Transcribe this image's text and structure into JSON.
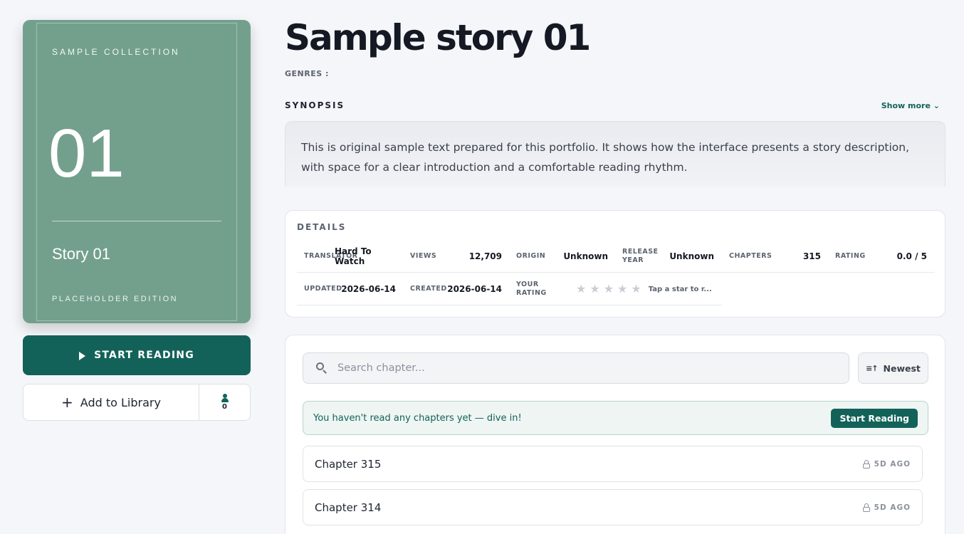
{
  "cover": {
    "collection": "SAMPLE COLLECTION",
    "number": "01",
    "title": "Story 01",
    "edition": "PLACEHOLDER EDITION"
  },
  "actions": {
    "start_reading": "START READING",
    "add_to_library": "Add to Library",
    "follower_count": "0"
  },
  "story": {
    "title": "Sample story 01",
    "genres_label": "GENRES :",
    "synopsis_label": "SYNOPSIS",
    "show_more": "Show more ⌄",
    "synopsis": "This is original sample text prepared for this portfolio. It shows how the interface presents a story description, with space for a clear introduction and a comfortable reading rhythm."
  },
  "details": {
    "title": "DETAILS",
    "translator_label": "TRANSLATOR",
    "translator_value": "Hard To Watch",
    "views_label": "VIEWS",
    "views_value": "12,709",
    "origin_label": "ORIGIN",
    "origin_value": "Unknown",
    "release_year_label": "RELEASE YEAR",
    "release_year_value": "Unknown",
    "chapters_label": "CHAPTERS",
    "chapters_value": "315",
    "rating_label": "RATING",
    "rating_value": "0.0 / 5",
    "updated_label": "UPDATED",
    "updated_value": "2026-06-14",
    "created_label": "CREATED",
    "created_value": "2026-06-14",
    "your_rating_label": "YOUR RATING",
    "your_rating_stars": 0,
    "tap_hint": "Tap a star to r..."
  },
  "chapters": {
    "search_placeholder": "Search chapter...",
    "sort_label": "Newest",
    "progress_message": "You haven't read any chapters yet — dive in!",
    "progress_button": "Start Reading",
    "items": [
      {
        "name": "Chapter 315",
        "time": "5D AGO"
      },
      {
        "name": "Chapter 314",
        "time": "5D AGO"
      }
    ]
  },
  "colors": {
    "accent": "#136259",
    "cover": "#73a08d",
    "background": "#f5f6fa"
  }
}
